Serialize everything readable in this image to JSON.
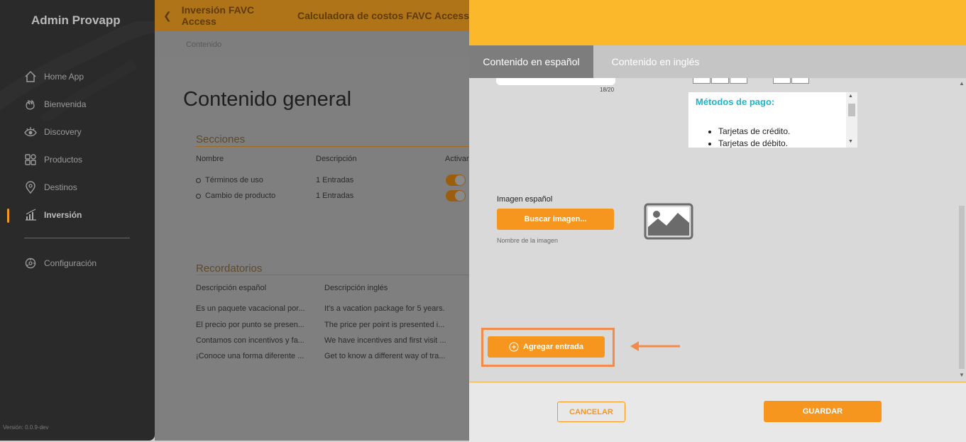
{
  "sidebar": {
    "app_title": "Admin Provapp",
    "items": [
      {
        "label": "Home App",
        "icon": "home-icon"
      },
      {
        "label": "Bienvenida",
        "icon": "waving-hand-icon"
      },
      {
        "label": "Discovery",
        "icon": "eye-icon"
      },
      {
        "label": "Productos",
        "icon": "grid-icon"
      },
      {
        "label": "Destinos",
        "icon": "location-pin-icon"
      },
      {
        "label": "Inversión",
        "icon": "bar-chart-icon"
      },
      {
        "label": "Configuración",
        "icon": "gear-icon"
      }
    ],
    "version": "Versión: 0.0.9-dev"
  },
  "header": {
    "crumb1": "Inversión FAVC Access",
    "crumb2": "Calculadora de costos FAVC Access",
    "subcrumb": "Contenido"
  },
  "page": {
    "title": "Contenido general",
    "sections_title": "Secciones",
    "sections_headers": {
      "name": "Nombre",
      "desc": "Descripción",
      "active": "Activar"
    },
    "sections_rows": [
      {
        "name": "Términos de uso",
        "desc": "1 Entradas"
      },
      {
        "name": "Cambio de producto",
        "desc": "1 Entradas"
      }
    ],
    "reminders_title": "Recordatorios",
    "reminders_headers": {
      "es": "Descripción español",
      "en": "Descripción inglés"
    },
    "reminders_rows": [
      {
        "es": "Es un paquete vacacional por...",
        "en": "It's a vacation package for 5 years."
      },
      {
        "es": "El precio por punto se presen...",
        "en": "The price per point is presented i..."
      },
      {
        "es": "Contamos con incentivos y fa...",
        "en": "We have incentives and first visit ..."
      },
      {
        "es": "¡Conoce una forma diferente ...",
        "en": "Get to know a different way of tra..."
      }
    ]
  },
  "panel": {
    "tabs": [
      "Contenido en español",
      "Contenido en inglés"
    ],
    "char_count": "18/20",
    "editor_title": "Métodos de pago:",
    "editor_items": [
      "Tarjetas de crédito.",
      "Tarjetas de débito."
    ],
    "image_label": "Imagen español",
    "search_image_button": "Buscar imagen...",
    "image_name_placeholder": "Nombre de la imagen",
    "add_entry_button": "Agregar entrada",
    "cancel_button": "CANCELAR",
    "save_button": "GUARDAR"
  },
  "colors": {
    "accent": "#f7961f",
    "header_yellow": "#fab82a",
    "editor_title": "#1fb5c9",
    "highlight": "#f28b4b"
  }
}
